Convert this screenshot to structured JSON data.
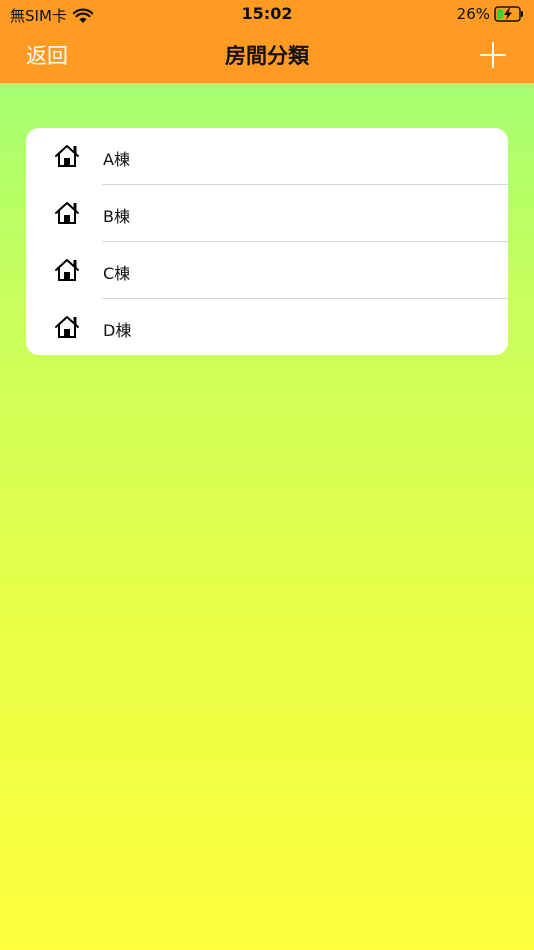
{
  "status_bar": {
    "carrier": "無SIM卡",
    "time": "15:02",
    "battery": "26%"
  },
  "nav": {
    "back_label": "返回",
    "title": "房間分類",
    "add_icon": "plus-icon"
  },
  "rooms": [
    {
      "label": "A棟",
      "icon": "house-icon"
    },
    {
      "label": "B棟",
      "icon": "house-icon"
    },
    {
      "label": "C棟",
      "icon": "house-icon"
    },
    {
      "label": "D棟",
      "icon": "house-icon"
    }
  ],
  "colors": {
    "header": "#ff9b23",
    "gradient_top": "#97ff78",
    "gradient_bottom": "#fdff3c"
  }
}
